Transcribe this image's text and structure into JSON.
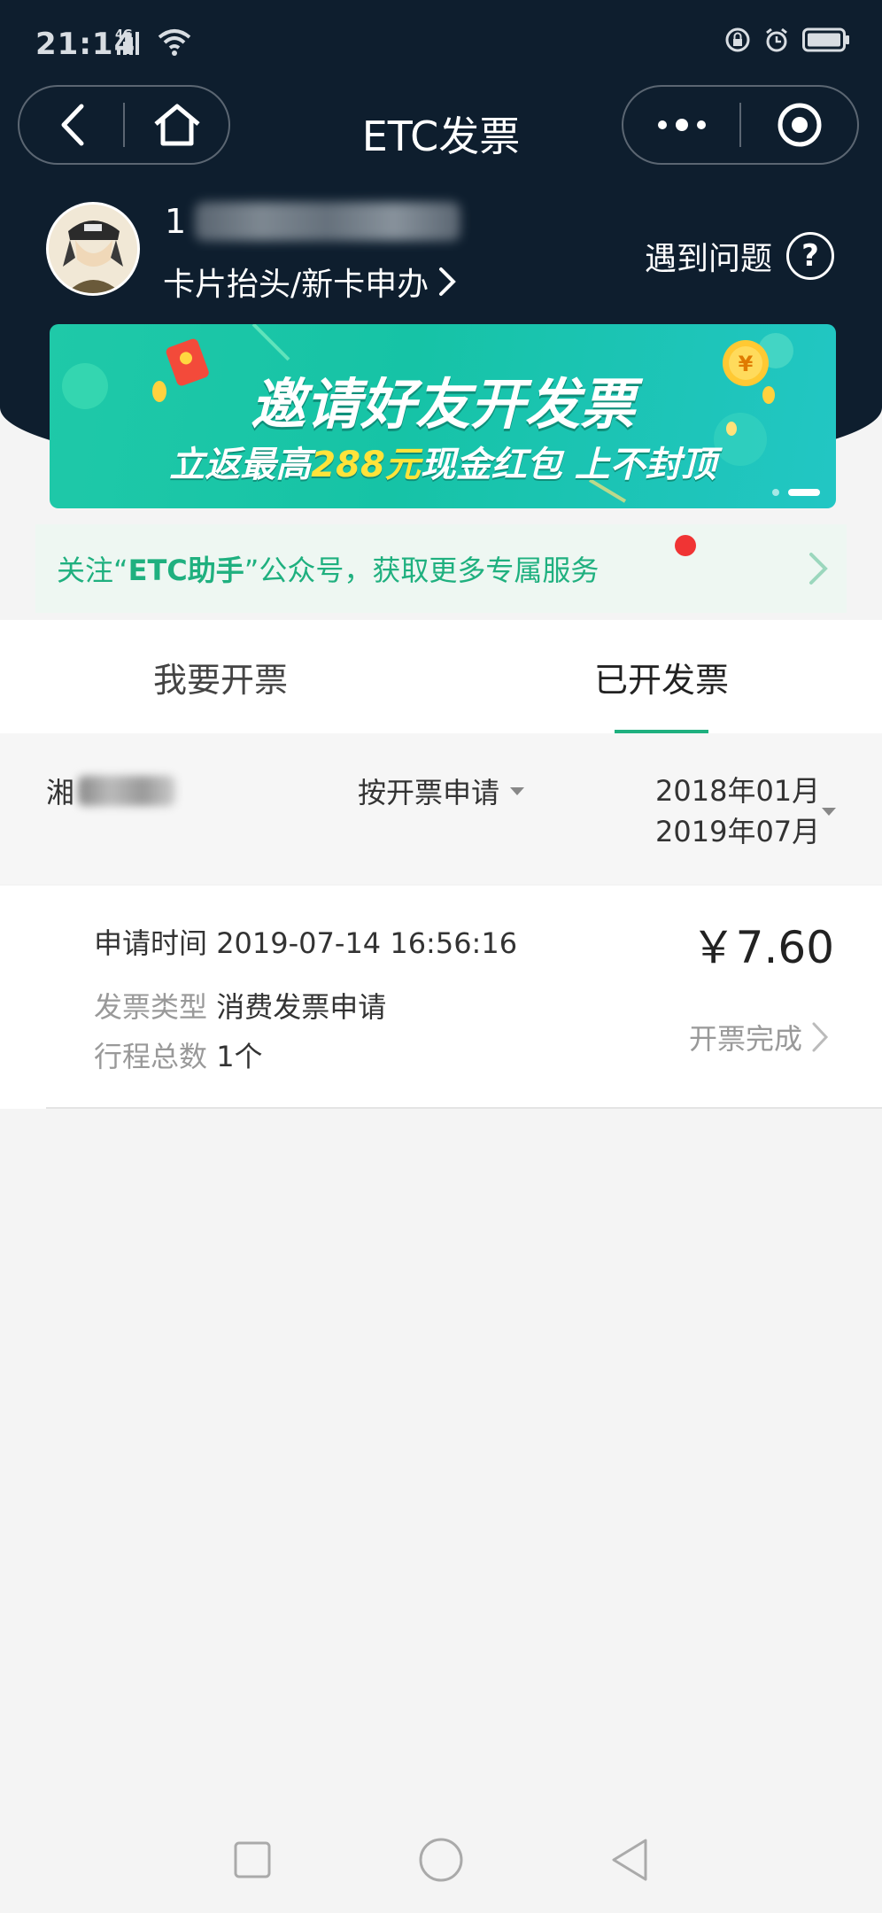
{
  "status_bar": {
    "time": "21:14",
    "network": "4G"
  },
  "nav": {
    "title": "ETC发票"
  },
  "user": {
    "phone_prefix": "1",
    "card_link": "卡片抬头/新卡申办",
    "help": "遇到问题"
  },
  "banner": {
    "title": "邀请好友开发票",
    "subtitle_prefix": "立返最高",
    "subtitle_highlight": "288元",
    "subtitle_mid": "现金红包",
    "subtitle_suffix": "上不封顶"
  },
  "notice": {
    "text_prefix": "关注“",
    "text_bold": "ETC助手",
    "text_suffix": "”公众号，获取更多专属服务"
  },
  "tabs": [
    {
      "label": "我要开票"
    },
    {
      "label": "已开发票"
    }
  ],
  "filters": {
    "plate_prefix": "湘",
    "type": "按开票申请",
    "date_start": "2018年01月",
    "date_end": "2019年07月"
  },
  "invoice": {
    "time_label": "申请时间",
    "time_value": "2019-07-14 16:56:16",
    "amount": "￥7.60",
    "type_label": "发票类型",
    "type_value": "消费发票申请",
    "trips_label": "行程总数",
    "trips_value": "1个",
    "status": "开票完成"
  },
  "colors": {
    "header": "#0e1e2e",
    "accent": "#1fb07f",
    "banner": "#1fc9a8",
    "badge": "#f03434"
  }
}
